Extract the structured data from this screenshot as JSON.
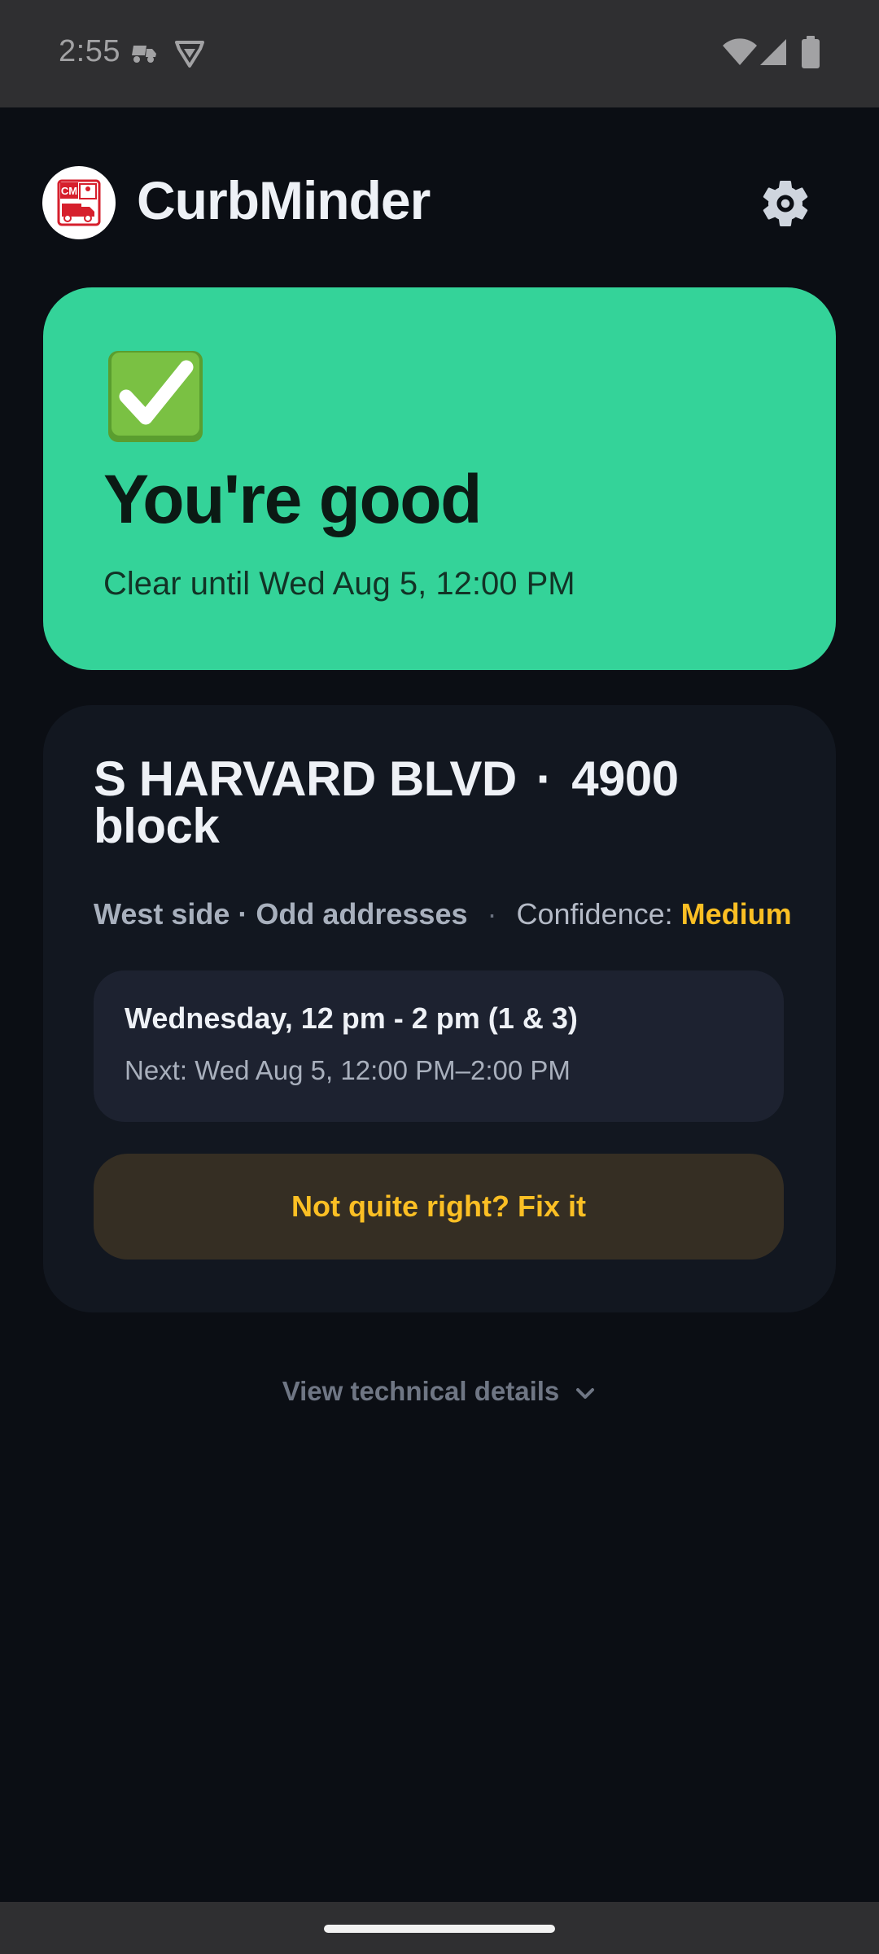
{
  "status_bar": {
    "time": "2:55",
    "icons": [
      "truck-notification-icon",
      "vpn-shield-icon",
      "wifi-icon",
      "cell-signal-icon",
      "battery-icon"
    ]
  },
  "header": {
    "app_name": "CurbMinder",
    "logo_text": "CM",
    "settings_icon": "gear-icon"
  },
  "status_card": {
    "icon": "check-mark-button-icon",
    "title": "You're good",
    "subtitle": "Clear until Wed Aug 5, 12:00 PM",
    "background": "#34d399"
  },
  "location": {
    "street": "S HARVARD BLVD",
    "separator": "·",
    "block": "4900 block",
    "side": "West side · Odd addresses",
    "meta_separator": "·",
    "confidence_label": "Confidence:",
    "confidence_value": "Medium",
    "confidence_color": "#fbbf24",
    "schedule": {
      "title": "Wednesday, 12 pm - 2 pm (1 & 3)",
      "next": "Next: Wed Aug 5, 12:00 PM–2:00 PM"
    },
    "fix_button_label": "Not quite right? Fix it"
  },
  "technical_details": {
    "label": "View technical details",
    "icon": "chevron-down-icon"
  }
}
